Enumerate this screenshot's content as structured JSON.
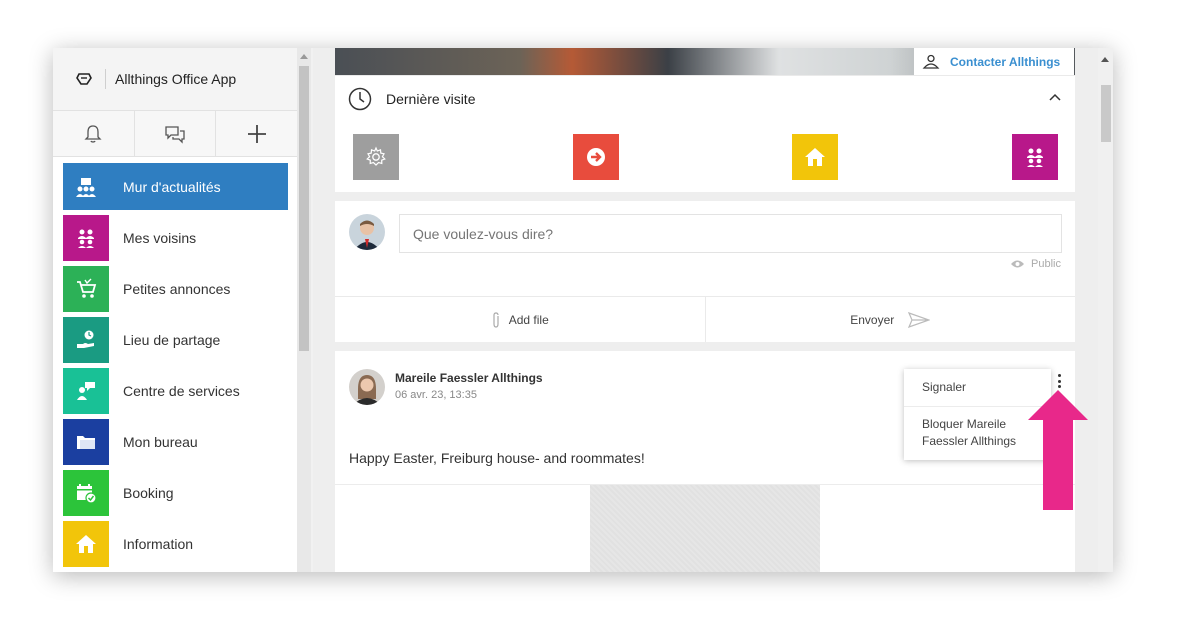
{
  "app": {
    "title": "Allthings Office App"
  },
  "sidebar": {
    "items": [
      {
        "label": "Mur d'actualités",
        "color": "#2f7ec1",
        "icon": "newsfeed-icon",
        "active": true
      },
      {
        "label": "Mes voisins",
        "color": "#b8188a",
        "icon": "neighbors-icon"
      },
      {
        "label": "Petites annonces",
        "color": "#2cb157",
        "icon": "cart-icon"
      },
      {
        "label": "Lieu de partage",
        "color": "#1a9b82",
        "icon": "sharing-icon"
      },
      {
        "label": "Centre de services",
        "color": "#19c196",
        "icon": "service-center-icon"
      },
      {
        "label": "Mon bureau",
        "color": "#1b3fa0",
        "icon": "folder-icon"
      },
      {
        "label": "Booking",
        "color": "#2cc43a",
        "icon": "calendar-icon"
      },
      {
        "label": "Information",
        "color": "#f2c50a",
        "icon": "home-icon"
      }
    ]
  },
  "header": {
    "contact_label": "Contacter Allthings"
  },
  "last_visit": {
    "title": "Dernière visite",
    "tiles": [
      {
        "color": "#9e9e9e",
        "icon": "settings-icon"
      },
      {
        "color": "#e84c3d",
        "icon": "arrow-circle-icon"
      },
      {
        "color": "#f2c50a",
        "icon": "home-icon"
      },
      {
        "color": "#b8188a",
        "icon": "neighbors-icon"
      }
    ]
  },
  "composer": {
    "placeholder": "Que voulez-vous dire?",
    "privacy": "Public",
    "add_file": "Add file",
    "send": "Envoyer"
  },
  "post": {
    "author": "Mareile Faessler Allthings",
    "date": "06 avr. 23, 13:35",
    "text": "Happy Easter, Freiburg house- and roommates!"
  },
  "post_menu": {
    "items": [
      "Signaler",
      "Bloquer Mareile Faessler Allthings"
    ]
  },
  "colors": {
    "accent": "#2f7ec1",
    "link": "#3a8fd0",
    "callout": "#e8288a"
  }
}
